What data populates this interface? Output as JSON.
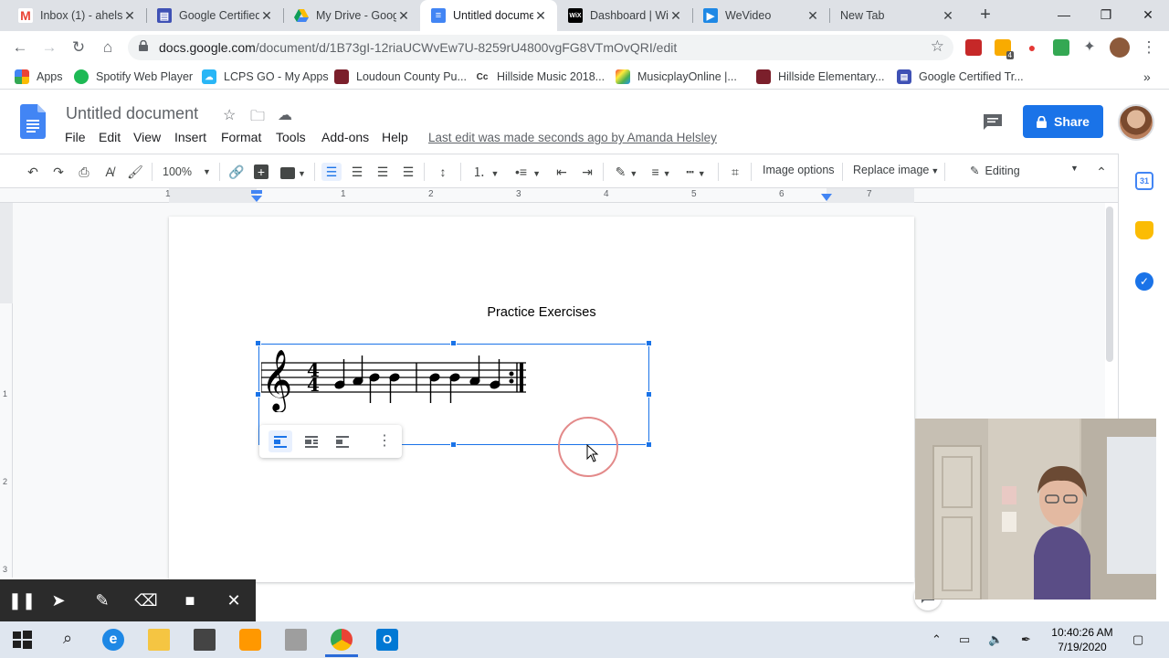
{
  "browser": {
    "tabs": [
      {
        "title": "Inbox (1) - ahels",
        "favicon": "gmail-icon"
      },
      {
        "title": "Google Certified",
        "favicon": "google-sites-icon"
      },
      {
        "title": "My Drive - Goog",
        "favicon": "google-drive-icon"
      },
      {
        "title": "Untitled docume",
        "favicon": "google-docs-icon"
      },
      {
        "title": "Dashboard | Wi",
        "favicon": "wix-icon"
      },
      {
        "title": "WeVideo",
        "favicon": "wevideo-icon"
      },
      {
        "title": "New Tab",
        "favicon": ""
      }
    ],
    "url_host": "docs.google.com",
    "url_path": "/document/d/1B73gI-12riaUCWvEw7U-8259rU4800vgFG8VTmOvQRI/edit",
    "bookmarks": [
      {
        "label": "Apps"
      },
      {
        "label": "Spotify Web Player"
      },
      {
        "label": "LCPS GO - My Apps"
      },
      {
        "label": "Loudoun County Pu..."
      },
      {
        "label": "Hillside Music 2018..."
      },
      {
        "label": "MusicplayOnline |..."
      },
      {
        "label": "Hillside Elementary..."
      },
      {
        "label": "Google Certified Tr..."
      }
    ],
    "extension_badge": "4"
  },
  "docs": {
    "title": "Untitled document",
    "menu": [
      "File",
      "Edit",
      "View",
      "Insert",
      "Format",
      "Tools",
      "Add-ons",
      "Help"
    ],
    "last_edit": "Last edit was made seconds ago by Amanda Helsley",
    "share_label": "Share",
    "toolbar": {
      "zoom": "100%",
      "image_options": "Image options",
      "replace_image": "Replace image",
      "mode": "Editing"
    },
    "ruler_numbers": [
      "1",
      "1",
      "2",
      "3",
      "4",
      "5",
      "6",
      "7"
    ],
    "vruler_numbers": [
      "1",
      "2",
      "3"
    ],
    "heading": "Practice Exercises"
  },
  "taskbar": {
    "time": "10:40:26 AM",
    "date": "7/19/2020"
  },
  "colors": {
    "accent": "#1a73e8",
    "tab_strip": "#dee1e6",
    "recording_bar": "#2b2b2b",
    "cursor_ring": "#e38a8a"
  }
}
